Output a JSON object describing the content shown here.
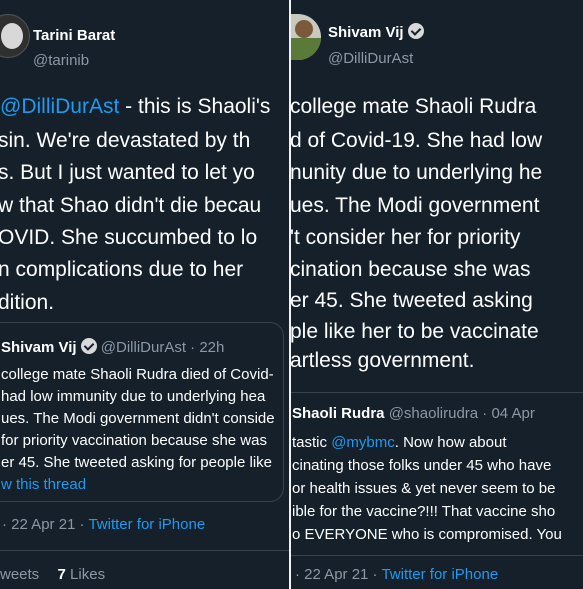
{
  "left": {
    "author": {
      "name": "Tarini Barat",
      "handle": "@tarinib"
    },
    "tweet_lines": [
      {
        "link": "@DilliDurAst",
        "text": " - this is Shaoli's"
      },
      {
        "text": "sin.  We're devastated by th"
      },
      {
        "text": "s. But I just wanted to let yo"
      },
      {
        "text": "w that Shao didn't die becau"
      },
      {
        "text": "OVID. She succumbed to lo"
      },
      {
        "text": "n complications due to her"
      },
      {
        "text": "dition."
      }
    ],
    "quoted": {
      "name": "Shivam Vij",
      "handle": "@DilliDurAst",
      "time": "· 22h",
      "lines": [
        "college mate Shaoli Rudra died of Covid-",
        "had low immunity due to underlying hea",
        "ues. The Modi government didn't conside",
        "for priority vaccination because she was",
        "er 45. She tweeted asking for people like"
      ],
      "show_thread": "w this thread"
    },
    "meta": {
      "date": "· 22 Apr 21 ·",
      "source": "Twitter for iPhone"
    },
    "stats": {
      "retweets_label": "weets",
      "likes_count": "7",
      "likes_label": "Likes"
    }
  },
  "right": {
    "author": {
      "name": "Shivam Vij",
      "handle": "@DilliDurAst"
    },
    "tweet_lines": [
      "college mate Shaoli Rudra",
      "d of Covid-19. She had low",
      "nunity due to underlying he",
      "ues. The Modi government",
      "'t consider her for priority",
      "cination because she was",
      "er 45. She tweeted asking",
      "ple like her to be vaccinate",
      "artless government."
    ],
    "quoted": {
      "name": "Shaoli Rudra",
      "handle": "@shaolirudra",
      "time": "· 04 Apr",
      "lines": [
        {
          "text": "tastic ",
          "link": "@mybmc",
          "after": ". Now how about"
        },
        {
          "text": "cinating those folks under 45 who have"
        },
        {
          "text": "or health issues & yet never seem to be"
        },
        {
          "text": "ible for the vaccine?!!! That vaccine sho"
        },
        {
          "text": "o EVERYONE who is compromised. You"
        }
      ]
    },
    "meta": {
      "date": "· 22 Apr 21 ·",
      "source": "Twitter for iPhone"
    }
  },
  "colors": {
    "background": "#15202b",
    "text": "#ffffff",
    "muted": "#8b98a5",
    "link": "#1d9bf0",
    "border": "#38444d"
  }
}
